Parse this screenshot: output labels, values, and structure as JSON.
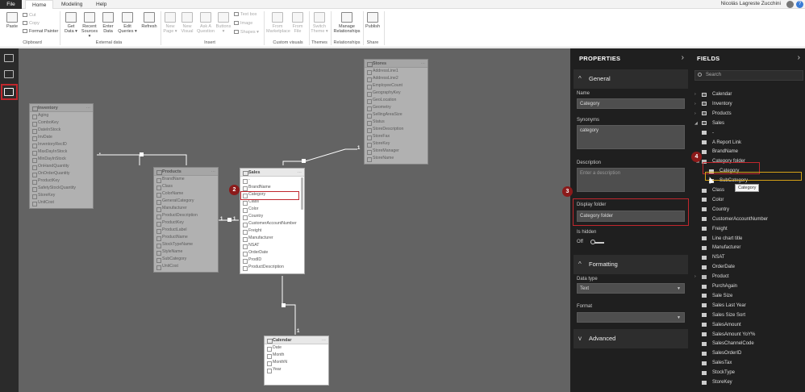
{
  "menubar": {
    "tabs": [
      {
        "label": "File",
        "active": false
      },
      {
        "label": "Home",
        "active": true
      },
      {
        "label": "Modeling",
        "active": false
      },
      {
        "label": "Help",
        "active": false
      }
    ],
    "user_name": "Nicolás Lagreste Zucchini",
    "help_icon": "?"
  },
  "ribbon": {
    "paste": "Paste",
    "cut": "Cut",
    "copy": "Copy",
    "format_painter": "Format Painter",
    "get_data": "Get Data ▾",
    "recent_sources": "Recent Sources ▾",
    "enter_data": "Enter Data",
    "edit_queries": "Edit Queries ▾",
    "refresh": "Refresh",
    "new_page": "New Page ▾",
    "new_visual": "New Visual",
    "ask_question": "Ask A Question",
    "buttons": "Buttons ▾",
    "text_box": "Text box",
    "image": "Image",
    "shapes": "Shapes ▾",
    "from_marketplace": "From Marketplace",
    "from_file": "From File",
    "switch_theme": "Switch Theme ▾",
    "manage_relationships": "Manage Relationships",
    "publish": "Publish",
    "groups": {
      "clipboard": "Clipboard",
      "external_data": "External data",
      "insert": "Insert",
      "custom_visuals": "Custom visuals",
      "themes": "Themes",
      "relationships": "Relationships",
      "share": "Share"
    }
  },
  "canvas": {
    "tables": {
      "inventory": {
        "name": "Inventory",
        "fields": [
          "Aging",
          "ComboKey",
          "DateInStock",
          "InvDate",
          "InventoryRecID",
          "MaxDayInStock",
          "MinDayInStock",
          "OnHandQuantity",
          "OnOrderQuantity",
          "ProductKey",
          "SafetyStockQuantity",
          "StoreKey",
          "UnitCost"
        ]
      },
      "products": {
        "name": "Products",
        "fields": [
          "BrandName",
          "Class",
          "ColorName",
          "GeneralCategory",
          "Manufacturer",
          "ProductDescription",
          "ProductKey",
          "ProductLabel",
          "ProductName",
          "StockTypeName",
          "StyleName",
          "SubCategory",
          "UnitCost"
        ]
      },
      "sales": {
        "name": "Sales",
        "fields": [
          "-",
          "BrandName",
          "Category",
          "Class",
          "Color",
          "Country",
          "CustomerAccountNumber",
          "Freight",
          "Manufacturer",
          "NSAT",
          "OrderDate",
          "ProdID",
          "ProductDescription"
        ]
      },
      "stores": {
        "name": "Stores",
        "fields": [
          "AddressLine1",
          "AddressLine2",
          "EmployeeCount",
          "GeographyKey",
          "GeoLocation",
          "Geometry",
          "SellingAreaSize",
          "Status",
          "StoreDescription",
          "StoreFax",
          "StoreKey",
          "StoreManager",
          "StoreName"
        ]
      },
      "calendar": {
        "name": "Calendar",
        "fields": [
          "Date",
          "Month",
          "MonthN",
          "Year"
        ]
      }
    },
    "relationship_labels": [
      "1",
      "1",
      "1",
      "1",
      "1"
    ],
    "step_badges": [
      "1",
      "2",
      "3",
      "4"
    ]
  },
  "properties": {
    "title": "PROPERTIES",
    "general_section": "General",
    "name_label": "Name",
    "name_value": "Category",
    "synonyms_label": "Synonyms",
    "synonyms_value": "category",
    "description_label": "Description",
    "description_placeholder": "Enter a description",
    "display_folder_label": "Display folder",
    "display_folder_value": "Category folder",
    "is_hidden_label": "Is hidden",
    "is_hidden_value": "Off",
    "formatting_section": "Formatting",
    "data_type_label": "Data type",
    "data_type_value": "Text",
    "format_label": "Format",
    "format_value": "",
    "advanced_section": "Advanced"
  },
  "fields": {
    "title": "FIELDS",
    "search_placeholder": "Search",
    "items": [
      {
        "label": "Calendar",
        "type": "table",
        "expanded": false
      },
      {
        "label": "Inventory",
        "type": "table",
        "expanded": false
      },
      {
        "label": "Products",
        "type": "table",
        "expanded": false
      },
      {
        "label": "Sales",
        "type": "table",
        "expanded": true
      },
      {
        "label": "-",
        "type": "field"
      },
      {
        "label": "A Report Link",
        "type": "field"
      },
      {
        "label": "BrandName",
        "type": "field"
      },
      {
        "label": "Category folder",
        "type": "folder"
      },
      {
        "label": "Category",
        "type": "subfield"
      },
      {
        "label": "SubCategory",
        "type": "subfield"
      },
      {
        "label": "Class",
        "type": "field"
      },
      {
        "label": "Color",
        "type": "field"
      },
      {
        "label": "Country",
        "type": "field"
      },
      {
        "label": "CustomerAccountNumber",
        "type": "field"
      },
      {
        "label": "Freight",
        "type": "field"
      },
      {
        "label": "Line chart title",
        "type": "field"
      },
      {
        "label": "Manufacturer",
        "type": "field"
      },
      {
        "label": "NSAT",
        "type": "field"
      },
      {
        "label": "OrderDate",
        "type": "field"
      },
      {
        "label": "Product",
        "type": "folder"
      },
      {
        "label": "PurchAgain",
        "type": "field"
      },
      {
        "label": "Sale Size",
        "type": "field"
      },
      {
        "label": "Sales Last Year",
        "type": "field"
      },
      {
        "label": "Sales Size Sort",
        "type": "field"
      },
      {
        "label": "SalesAmount",
        "type": "field"
      },
      {
        "label": "SalesAmount YoY%",
        "type": "field"
      },
      {
        "label": "SalesChannelCode",
        "type": "field"
      },
      {
        "label": "SalesOrderID",
        "type": "field"
      },
      {
        "label": "SalesTax",
        "type": "field"
      },
      {
        "label": "StockType",
        "type": "field"
      },
      {
        "label": "StoreKey",
        "type": "field"
      }
    ],
    "tooltip": "Category"
  },
  "colors": {
    "accent_red": "#c0272d",
    "badge": "#8b1a1a",
    "dark_panel": "#1f1f1f",
    "canvas": "#636363"
  }
}
